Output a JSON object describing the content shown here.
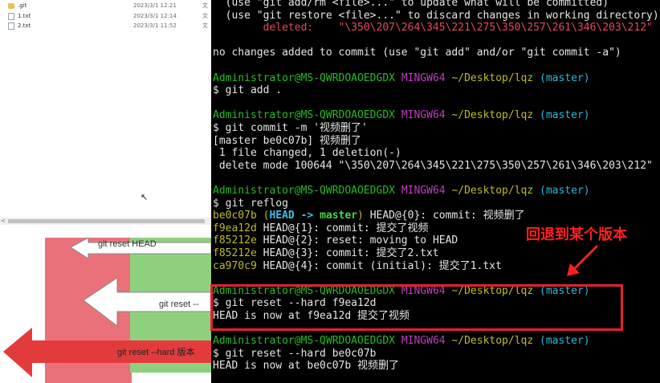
{
  "explorer": {
    "files": [
      {
        "name": ".git",
        "date": "2023/3/1 12:21",
        "type": "文",
        "icon": "folder-icon"
      },
      {
        "name": "1.txt",
        "date": "2023/3/1 12:14",
        "type": "文",
        "icon": "text-file-icon"
      },
      {
        "name": "2.txt",
        "date": "2023/3/1 11:52",
        "type": "文",
        "icon": "text-file-icon"
      }
    ],
    "scroll_arrow": "<"
  },
  "diagram": {
    "labels": {
      "top": "git reset HEAD",
      "middle": "git reset --",
      "bottom": "git reset --hard 版本"
    },
    "colors": {
      "red": "#e9727a",
      "green": "#8fd07f",
      "bright_red": "#e33b3b",
      "arrow_white": "#ffffff"
    }
  },
  "terminal": {
    "lines": [
      [
        {
          "t": "  (use \"git add/rm <file>...\" to update what will be committed)",
          "c": ""
        }
      ],
      [
        {
          "t": "  (use \"git restore <file>...\" to discard changes in working directory)",
          "c": ""
        }
      ],
      [
        {
          "t": "        deleted:    \"\\350\\207\\264\\345\\221\\275\\350\\257\\261\\346\\203\\212\"",
          "c": "c-red"
        }
      ],
      [
        {
          "t": "",
          "c": ""
        }
      ],
      [
        {
          "t": "no changes added to commit (use \"git add\" and/or \"git commit -a\")",
          "c": ""
        }
      ],
      [
        {
          "t": "",
          "c": ""
        }
      ],
      [
        {
          "t": "Administrator@MS-QWRDOAOEDGDX ",
          "c": "c-green"
        },
        {
          "t": "MINGW64 ",
          "c": "c-magenta"
        },
        {
          "t": "~/Desktop/lqz ",
          "c": "c-yellow"
        },
        {
          "t": "(master)",
          "c": "c-cyan"
        }
      ],
      [
        {
          "t": "$ git add .",
          "c": ""
        }
      ],
      [
        {
          "t": "",
          "c": ""
        }
      ],
      [
        {
          "t": "Administrator@MS-QWRDOAOEDGDX ",
          "c": "c-green"
        },
        {
          "t": "MINGW64 ",
          "c": "c-magenta"
        },
        {
          "t": "~/Desktop/lqz ",
          "c": "c-yellow"
        },
        {
          "t": "(master)",
          "c": "c-cyan"
        }
      ],
      [
        {
          "t": "$ git commit -m '视频删了'",
          "c": ""
        }
      ],
      [
        {
          "t": "[master be0c07b] 视频删了",
          "c": ""
        }
      ],
      [
        {
          "t": " 1 file changed, 1 deletion(-)",
          "c": ""
        }
      ],
      [
        {
          "t": " delete mode 100644 \"\\350\\207\\264\\345\\221\\275\\350\\257\\261\\346\\203\\212\"",
          "c": ""
        }
      ],
      [
        {
          "t": "",
          "c": ""
        }
      ],
      [
        {
          "t": "Administrator@MS-QWRDOAOEDGDX ",
          "c": "c-green"
        },
        {
          "t": "MINGW64 ",
          "c": "c-magenta"
        },
        {
          "t": "~/Desktop/lqz ",
          "c": "c-yellow"
        },
        {
          "t": "(master)",
          "c": "c-cyan"
        }
      ],
      [
        {
          "t": "$ git reflog",
          "c": ""
        }
      ],
      [
        {
          "t": "be0c07b ",
          "c": "c-yellow"
        },
        {
          "t": "(",
          "c": "c-yellow"
        },
        {
          "t": "HEAD -> ",
          "c": "c-cyan-bold"
        },
        {
          "t": "master",
          "c": "c-green-bold"
        },
        {
          "t": ")",
          "c": "c-yellow"
        },
        {
          "t": " HEAD@{0}: commit: 视频删了",
          "c": ""
        }
      ],
      [
        {
          "t": "f9ea12d ",
          "c": "c-yellow"
        },
        {
          "t": "HEAD@{1}: commit: 提交了视频",
          "c": ""
        }
      ],
      [
        {
          "t": "f85212e ",
          "c": "c-yellow"
        },
        {
          "t": "HEAD@{2}: reset: moving to HEAD",
          "c": ""
        }
      ],
      [
        {
          "t": "f85212e ",
          "c": "c-yellow"
        },
        {
          "t": "HEAD@{3}: commit: 提交了2.txt",
          "c": ""
        }
      ],
      [
        {
          "t": "ca970c9 ",
          "c": "c-yellow"
        },
        {
          "t": "HEAD@{4}: commit (initial): 提交了1.txt",
          "c": ""
        }
      ],
      [
        {
          "t": "",
          "c": ""
        }
      ],
      [
        {
          "t": "Administrator@MS-QWRDOAOEDGDX ",
          "c": "c-green"
        },
        {
          "t": "MINGW64 ",
          "c": "c-magenta"
        },
        {
          "t": "~/Desktop/lqz ",
          "c": "c-yellow"
        },
        {
          "t": "(master)",
          "c": "c-cyan"
        }
      ],
      [
        {
          "t": "$ git reset --hard f9ea12d",
          "c": ""
        }
      ],
      [
        {
          "t": "HEAD is now at f9ea12d 提交了视频",
          "c": ""
        }
      ],
      [
        {
          "t": "",
          "c": ""
        }
      ],
      [
        {
          "t": "Administrator@MS-QWRDOAOEDGDX ",
          "c": "c-green"
        },
        {
          "t": "MINGW64 ",
          "c": "c-magenta"
        },
        {
          "t": "~/Desktop/lqz ",
          "c": "c-yellow"
        },
        {
          "t": "(master)",
          "c": "c-cyan"
        }
      ],
      [
        {
          "t": "$ git reset --hard be0c07b",
          "c": ""
        }
      ],
      [
        {
          "t": "HEAD is now at be0c07b 视频删了",
          "c": ""
        }
      ]
    ],
    "colors": {
      "background": "#000000",
      "text": "#e6e6e6",
      "user_host": "#25bc24",
      "mingw": "#bc3fbc",
      "path": "#bcbc24",
      "branch": "#29b8db",
      "deleted": "#e74856"
    }
  },
  "annotation": {
    "text": "回退到某个版本",
    "color": "#ff2020"
  }
}
